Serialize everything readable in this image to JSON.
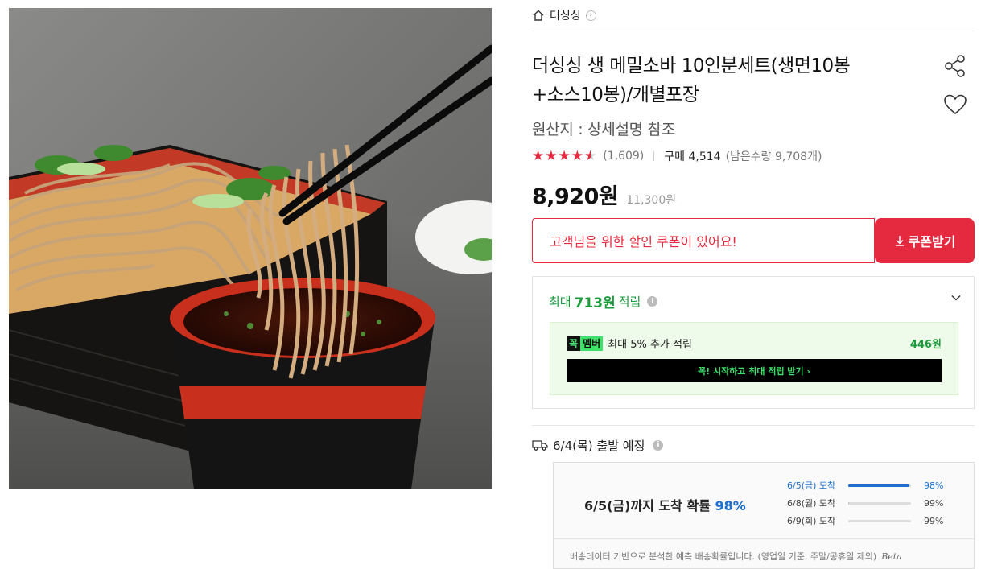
{
  "store": {
    "name": "더싱싱"
  },
  "product": {
    "title_line1": "더싱싱 생 메밀소바 10인분세트(생면10봉",
    "title_line2": "+소스10봉)/개별포장",
    "origin": "원산지 : 상세설명 참조",
    "rating": 4.5,
    "review_count": "(1,609)",
    "purchase": "구매 4,514",
    "stock": "(남은수량 9,708개)",
    "price": "8,920원",
    "original_price": "11,300원"
  },
  "coupon": {
    "message": "고객님을 위한 할인 쿠폰이 있어요!",
    "button_label": "쿠폰받기"
  },
  "points": {
    "prefix": "최대",
    "amount": "713원",
    "suffix": "적립",
    "member_badge_a": "꼭",
    "member_badge_b": "멤버",
    "member_text": "최대 5% 추가 적립",
    "member_amount": "446원",
    "member_button": "꼭! 시작하고 최대 적립 받기 ›"
  },
  "shipping": {
    "departure": "6/4(목) 출발 예정",
    "headline_prefix": "6/5(금)까지 도착 확률",
    "headline_pct": "98%",
    "rows": [
      {
        "label": "6/5(금) 도착",
        "value": "98%",
        "fraction": 0.98
      },
      {
        "label": "6/8(월) 도착",
        "value": "99%",
        "fraction": 0.01
      },
      {
        "label": "6/9(회) 도착",
        "value": "99%",
        "fraction": 0.0
      }
    ],
    "note": "배송데이터 기반으로 분석한 예측 배송확률입니다. (영업일 기준, 주말/공휴일 제외)",
    "beta": "Beta"
  },
  "colors": {
    "accent_red": "#e5293e",
    "points_green": "#1a9c3d",
    "member_green": "#3ee26b",
    "delivery_blue": "#1c6fd1"
  },
  "icons": [
    "home-icon",
    "chevron-right-icon",
    "share-icon",
    "heart-icon",
    "star-icon",
    "download-icon",
    "info-icon",
    "chevron-down-icon",
    "truck-icon"
  ]
}
